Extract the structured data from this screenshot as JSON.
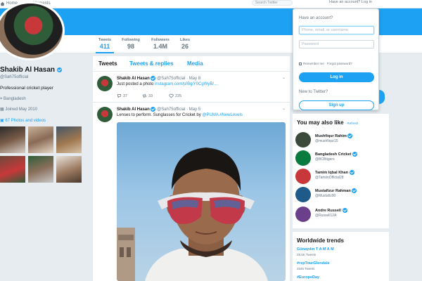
{
  "nav": {
    "home": "Home",
    "moments": "Moments",
    "search_placeholder": "Search Twitter",
    "account": "Have an account? Log in"
  },
  "colors": {
    "accent": "#1da1f2",
    "background": "#e6ecf0"
  },
  "stats": [
    {
      "label": "Tweets",
      "value": "411"
    },
    {
      "label": "Following",
      "value": "98"
    },
    {
      "label": "Followers",
      "value": "1.4M"
    },
    {
      "label": "Likes",
      "value": "26"
    }
  ],
  "profile": {
    "name": "Shakib Al Hasan",
    "handle": "@Sah75official",
    "bio": "Professional cricket player",
    "location": "Bangladesh",
    "joined": "Joined May 2010",
    "photos_link": "67 Photos and videos"
  },
  "tabs": [
    "Tweets",
    "Tweets & replies",
    "Media"
  ],
  "tweets": [
    {
      "name": "Shakib Al Hasan",
      "handle": "@Sah75official · May 8",
      "text": "Just posted a photo ",
      "link": "instagram.com/p/BgiY0CgWyB/...",
      "reply": "37",
      "retweet": "33",
      "like": "225"
    },
    {
      "name": "Shakib Al Hasan",
      "handle": "@Sah75official · May 5",
      "text": "Lenses to perform. Sunglasses for Cricket by ",
      "link": "@PUMA #NewLevels"
    }
  ],
  "login": {
    "header": "Have an account?",
    "username_placeholder": "Phone, email, or username",
    "password_placeholder": "Password",
    "remember": "Remember me · Forgot password?",
    "login_button": "Log in",
    "new_header": "New to Twitter?",
    "signup_button": "Sign up"
  },
  "who_to_follow": {
    "title": "You may also like",
    "refresh": "· Refresh",
    "items": [
      {
        "name": "Mushfiqur Rahim",
        "handle": "@mushfiqur15",
        "color": "#3b4a3a"
      },
      {
        "name": "Bangladesh Cricket",
        "handle": "@BCBtigers",
        "color": "#0a7a3d"
      },
      {
        "name": "Tamim Iqbal Khan",
        "handle": "@TamimOfficial28",
        "color": "#c8383a"
      },
      {
        "name": "Mustafizur Rahman",
        "handle": "@Mustafiz90",
        "color": "#1e5b8a"
      },
      {
        "name": "Andre Russell",
        "handle": "@Russell12A",
        "color": "#6b3f8a"
      }
    ]
  },
  "trends": {
    "title": "Worldwide trends",
    "items": [
      {
        "name": "Günaydın T A M A M",
        "count": "28.5K Tweets"
      },
      {
        "name": "#repTourGlendale",
        "count": "2546 Tweets"
      },
      {
        "name": "#EuropeDay",
        "count": ""
      }
    ]
  }
}
